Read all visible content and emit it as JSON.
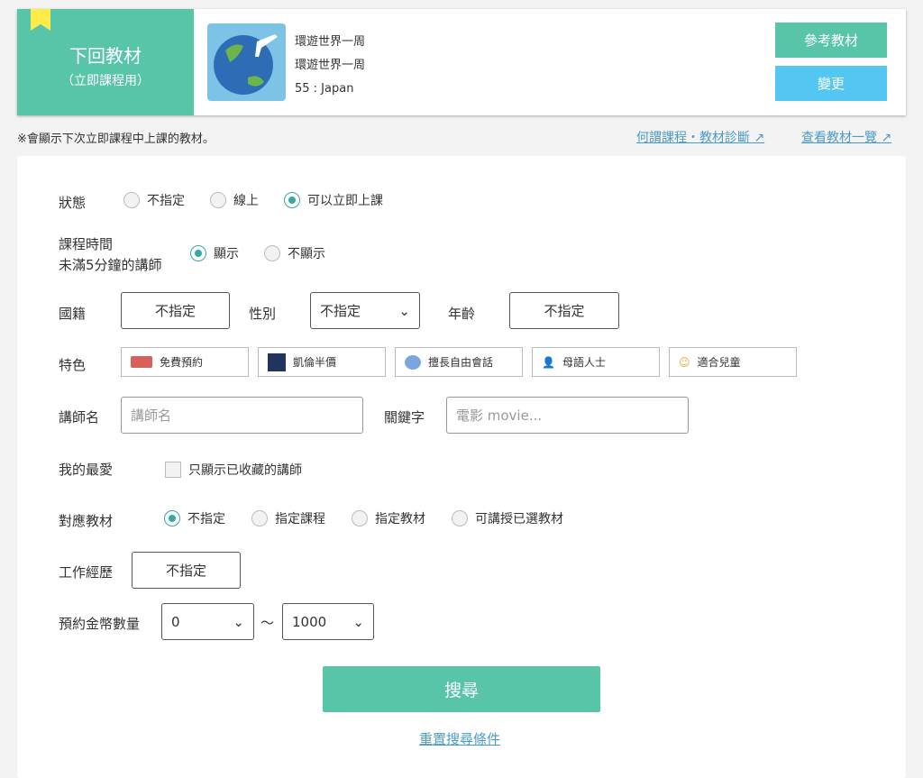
{
  "next": {
    "title": "下回教材",
    "subtitle": "（立即課程用）",
    "course": "環遊世界一周",
    "material": "環遊世界一周",
    "lesson": "55 : Japan",
    "ref_button": "參考教材",
    "change_button": "變更"
  },
  "note": "※會顯示下次立即課程中上課的教材。",
  "links": {
    "diagnosis": "何謂課程・教材診斷",
    "list": "查看教材一覽"
  },
  "form": {
    "status": {
      "label": "狀態",
      "options": [
        "不指定",
        "線上",
        "可以立即上課"
      ],
      "selected": 2
    },
    "time": {
      "label1": "課程時間",
      "label2": "未滿5分鐘的講師",
      "options": [
        "顯示",
        "不顯示"
      ],
      "selected": 0
    },
    "nationality": {
      "label": "國籍",
      "value": "不指定"
    },
    "gender": {
      "label": "性別",
      "value": "不指定"
    },
    "age": {
      "label": "年齡",
      "value": "不指定"
    },
    "features": {
      "label": "特色",
      "tags": [
        "免費預約",
        "凱倫半價",
        "擅長自由會話",
        "母語人士",
        "適合兒童"
      ]
    },
    "tutor_name": {
      "label": "講師名",
      "placeholder": "講師名"
    },
    "keyword": {
      "label": "關鍵字",
      "placeholder": "電影 movie..."
    },
    "favorite": {
      "label": "我的最愛",
      "checkbox": "只顯示已收藏的講師"
    },
    "material": {
      "label": "對應教材",
      "options": [
        "不指定",
        "指定課程",
        "指定教材",
        "可講授已選教材"
      ],
      "selected": 0
    },
    "experience": {
      "label": "工作經歷",
      "value": "不指定"
    },
    "coins": {
      "label": "預約金幣數量",
      "min": "0",
      "sep": "～",
      "max": "1000"
    },
    "search": "搜尋",
    "reset": "重置搜尋條件"
  }
}
